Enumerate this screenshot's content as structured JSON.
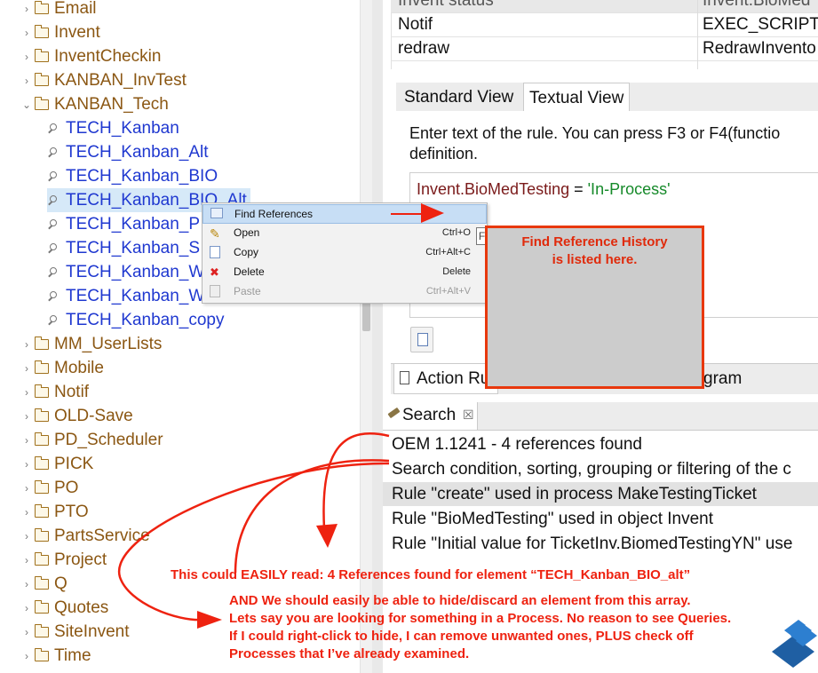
{
  "tree": {
    "folders_top": [
      {
        "label": "Email",
        "chev": "›"
      },
      {
        "label": "Invent",
        "chev": "›"
      },
      {
        "label": "InventCheckin",
        "chev": "›"
      },
      {
        "label": "KANBAN_InvTest",
        "chev": "›"
      },
      {
        "label": "KANBAN_Tech",
        "chev": "⌄"
      }
    ],
    "queries": [
      {
        "label": "TECH_Kanban"
      },
      {
        "label": "TECH_Kanban_Alt"
      },
      {
        "label": "TECH_Kanban_BIO"
      },
      {
        "label": "TECH_Kanban_BIO_Alt"
      },
      {
        "label": "TECH_Kanban_P"
      },
      {
        "label": "TECH_Kanban_S"
      },
      {
        "label": "TECH_Kanban_W"
      },
      {
        "label": "TECH_Kanban_W"
      },
      {
        "label": "TECH_Kanban_copy"
      }
    ],
    "folders_bottom": [
      {
        "label": "MM_UserLists"
      },
      {
        "label": "Mobile"
      },
      {
        "label": "Notif"
      },
      {
        "label": "OLD-Save"
      },
      {
        "label": "PD_Scheduler"
      },
      {
        "label": "PICK"
      },
      {
        "label": "PO"
      },
      {
        "label": "PTO"
      },
      {
        "label": "PartsService"
      },
      {
        "label": "Project"
      },
      {
        "label": "Q"
      },
      {
        "label": "Quotes"
      },
      {
        "label": "SiteInvent"
      },
      {
        "label": "Time"
      }
    ]
  },
  "table": {
    "header": [
      "Invent status",
      "Invent.BioMed"
    ],
    "rows": [
      [
        "Notif",
        "EXEC_SCRIPT"
      ],
      [
        "redraw",
        "RedrawInvento"
      ]
    ]
  },
  "editor": {
    "tabs": [
      "Standard View",
      "Textual View"
    ],
    "hint": "Enter text of the rule. You can press F3 or F4(functio definition.",
    "rule_field": "Invent.BioMedTesting",
    "rule_op": " = ",
    "rule_value": "'In-Process'"
  },
  "bottom_tabs": [
    "Action Ru",
    "gram"
  ],
  "search": {
    "title": "Search",
    "close": "☒",
    "results": [
      "OEM 1.1241 - 4 references found",
      "Search condition, sorting, grouping or filtering of the c",
      "Rule \"create\" used in process MakeTestingTicket",
      "Rule \"BioMedTesting\" used in object Invent",
      "Rule \"Initial value for TicketInv.BiomedTestingYN\" use"
    ]
  },
  "context_menu": {
    "items": [
      {
        "label": "Find References",
        "shortcut": "",
        "icon": "find-references-icon"
      },
      {
        "label": "Open",
        "shortcut": "Ctrl+O",
        "icon": "pencil-icon"
      },
      {
        "label": "Copy",
        "shortcut": "Ctrl+Alt+C",
        "icon": "copy-icon"
      },
      {
        "label": "Delete",
        "shortcut": "Delete",
        "icon": "delete-x-icon"
      },
      {
        "label": "Paste",
        "shortcut": "Ctrl+Alt+V",
        "icon": "paste-icon"
      }
    ],
    "peek_char": "F"
  },
  "annotations": {
    "box_text": "Find Reference History\nis listed here.",
    "line1": "This could EASILY read: 4 References found for element “TECH_Kanban_BIO_alt”",
    "line2": "AND We should easily be able to hide/discard an element from this array.",
    "line3": "Lets say you are looking for something in a Process.  No reason to see Queries.",
    "line4": "If I could right-click to hide, I can remove unwanted ones, PLUS check off",
    "line5": "Processes that I’ve already examined."
  },
  "colors": {
    "annotation_red": "#ee2210",
    "query_blue": "#1f38d0",
    "folder_brown": "#8b5713",
    "selection": "#d6e9f8"
  }
}
